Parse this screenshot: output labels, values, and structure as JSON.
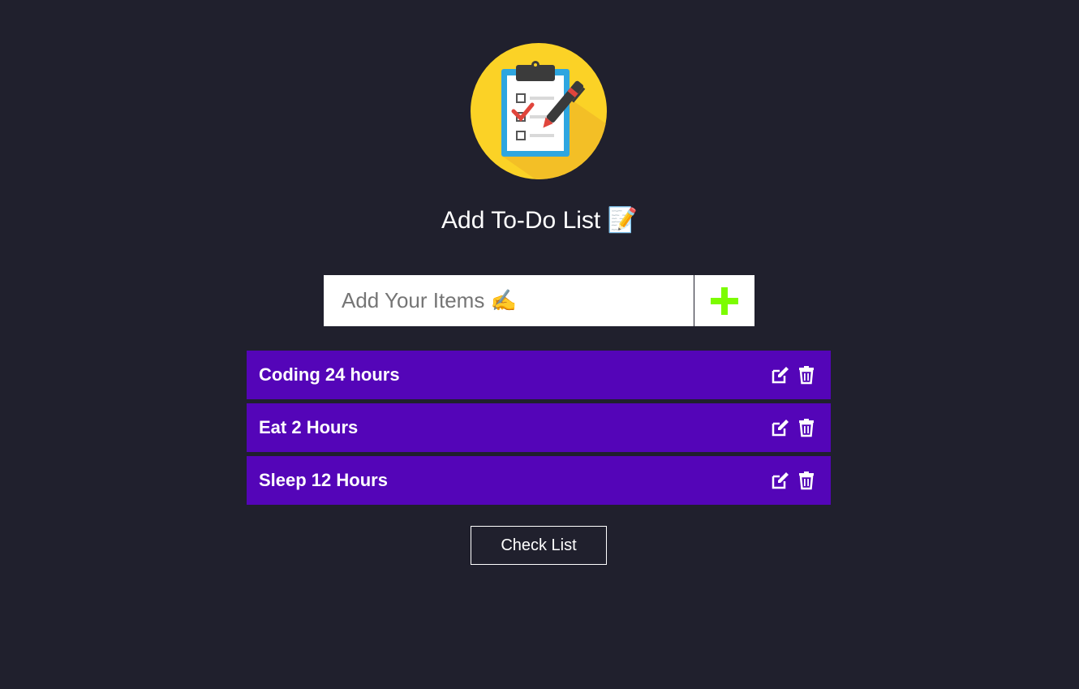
{
  "header": {
    "title": "Add To-Do List 📝",
    "logo_icon": "clipboard-checklist-icon"
  },
  "input": {
    "placeholder": "Add Your Items ✍",
    "value": "",
    "add_icon": "plus-icon",
    "add_color": "#7cfc00"
  },
  "items": [
    {
      "label": "Coding 24 hours"
    },
    {
      "label": "Eat 2 Hours"
    },
    {
      "label": "Sleep 12 Hours"
    }
  ],
  "item_icons": {
    "edit": "edit-icon",
    "delete": "trash-icon"
  },
  "check_button": {
    "label": "Check List"
  },
  "colors": {
    "background": "#20202d",
    "item_bg": "#5405b8",
    "logo_yellow": "#fbd226"
  }
}
